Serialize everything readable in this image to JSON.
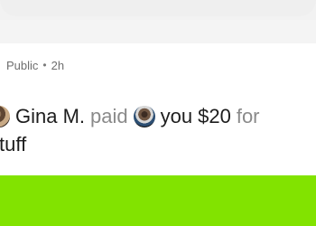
{
  "feed": {
    "post": {
      "visibility": "Public",
      "separator": "•",
      "time_ago": "2h",
      "actor": "Gina M.",
      "verb": "paid",
      "recipient": "you",
      "amount": "$20",
      "preposition": "for",
      "note": "tuff"
    }
  },
  "colors": {
    "accent_green": "#82e300",
    "text_primary": "#1d1d1d",
    "text_muted": "#8a8a8a"
  },
  "icons": {
    "actor_avatar": "user-avatar",
    "recipient_avatar": "user-avatar"
  }
}
